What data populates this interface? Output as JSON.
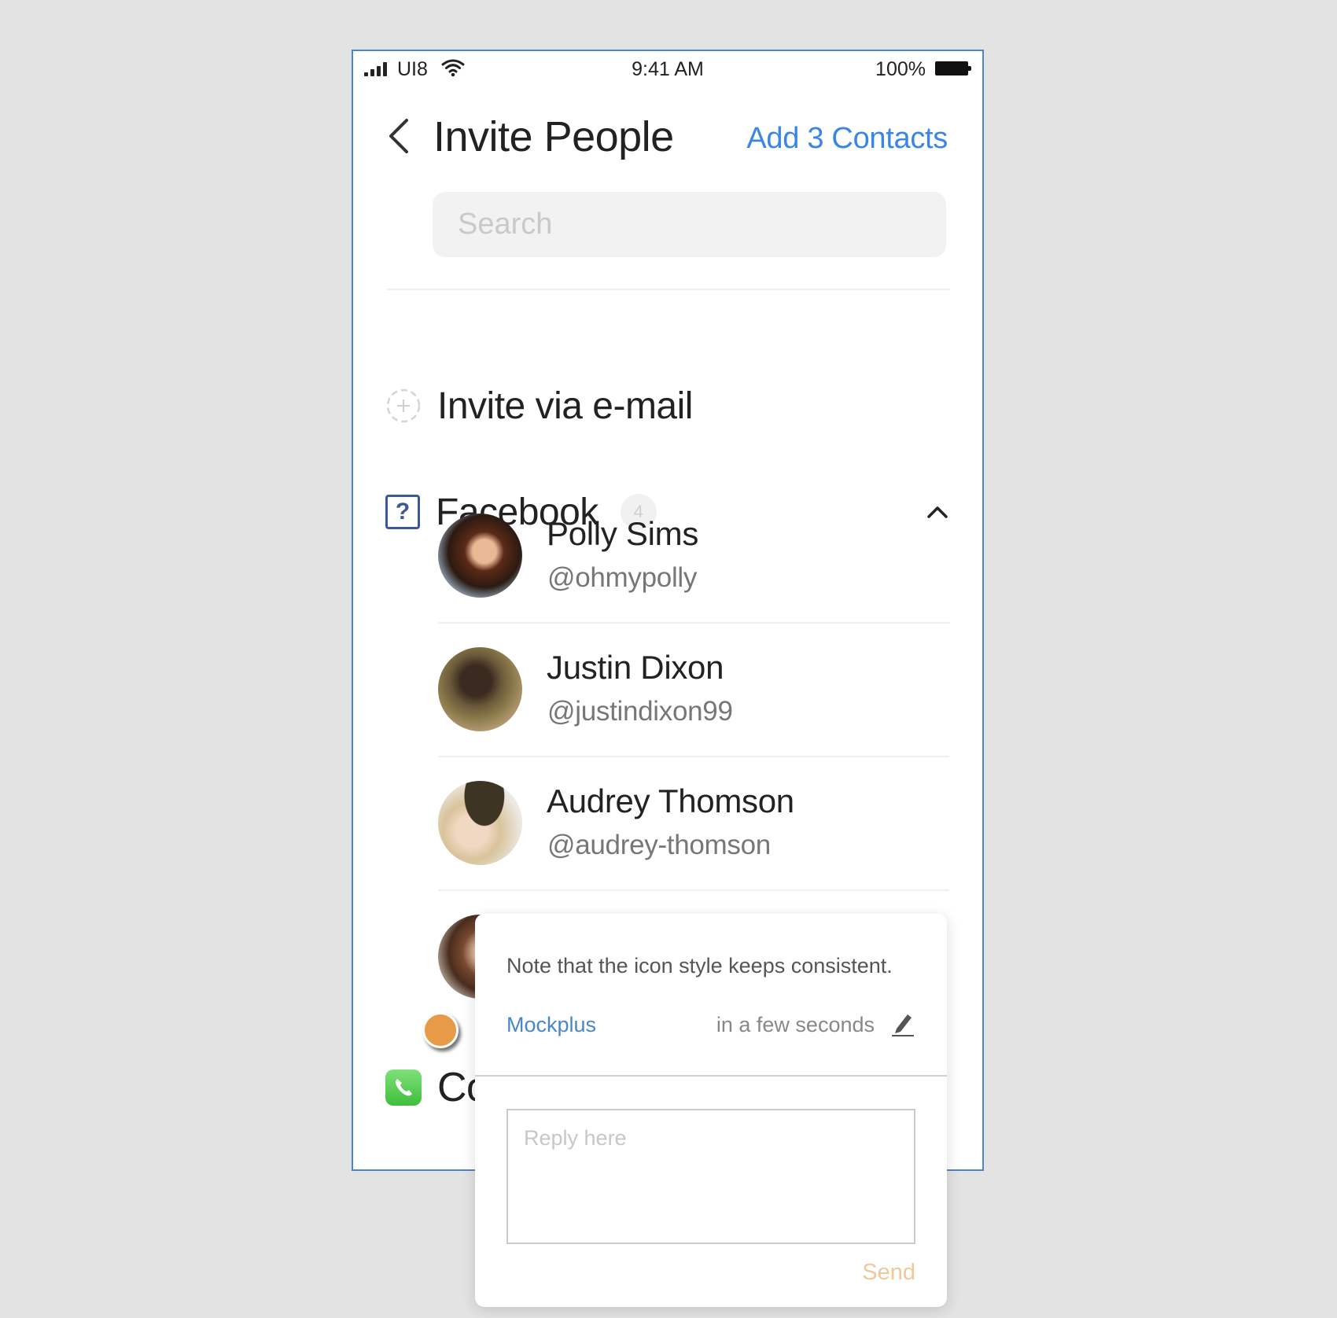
{
  "status_bar": {
    "carrier": "UI8",
    "time": "9:41 AM",
    "battery": "100%",
    "icons": [
      "signal-icon",
      "wifi-icon",
      "battery-icon"
    ]
  },
  "header": {
    "back_icon": "chevron-left-icon",
    "title": "Invite People",
    "action": "Add 3 Contacts",
    "accent_color": "#3a86e8"
  },
  "search": {
    "placeholder": "Search",
    "value": ""
  },
  "invite_email": {
    "icon": "dashed-plus-circle-icon",
    "label": "Invite via e-mail"
  },
  "facebook": {
    "icon": "facebook-placeholder-icon",
    "label": "Facebook",
    "count": "4",
    "expanded": true,
    "contacts": [
      {
        "name": "Polly Sims",
        "handle": "@ohmypolly"
      },
      {
        "name": "Justin Dixon",
        "handle": "@justindixon99"
      },
      {
        "name": "Audrey Thomson",
        "handle": "@audrey-thomson"
      },
      {
        "name": "",
        "handle": ""
      }
    ]
  },
  "contacts_section": {
    "icon": "phone-icon",
    "label": "Co"
  },
  "comment_popup": {
    "note": "Note that the icon style keeps consistent.",
    "author": "Mockplus",
    "timestamp": "in a few seconds",
    "reply_placeholder": "Reply here",
    "send_label": "Send",
    "marker_color": "#e99a47"
  }
}
